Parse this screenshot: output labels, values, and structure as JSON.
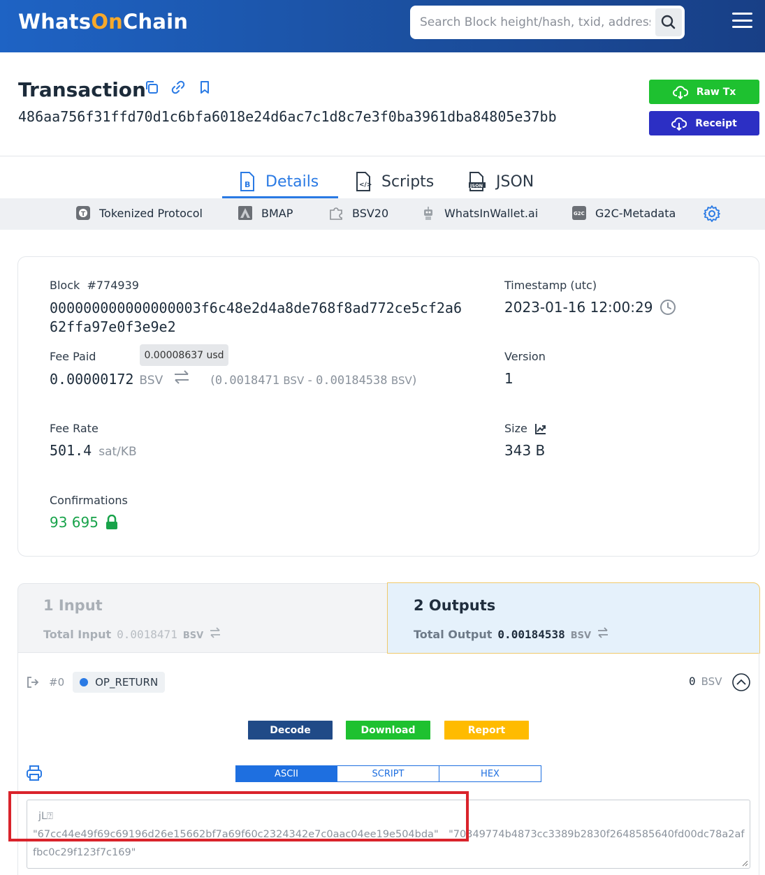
{
  "header": {
    "logo_part1": "Whats",
    "logo_part2": "On",
    "logo_part3": "Chain",
    "search_placeholder": "Search Block height/hash, txid, address"
  },
  "tx": {
    "title": "Transaction",
    "hash": "486aa756f31ffd70d1c6bfa6018e24d6ac7c1d8c7e3f0ba3961dba84805e37bb",
    "raw_tx_label": "Raw Tx",
    "receipt_label": "Receipt"
  },
  "tabs": [
    {
      "label": "Details",
      "icon": "bitcoin-doc-icon"
    },
    {
      "label": "Scripts",
      "icon": "code-doc-icon"
    },
    {
      "label": "JSON",
      "icon": "json-doc-icon"
    }
  ],
  "plugins": [
    {
      "label": "Tokenized Protocol",
      "icon": "tokenized-icon"
    },
    {
      "label": "BMAP",
      "icon": "bmap-icon"
    },
    {
      "label": "BSV20",
      "icon": "puzzle-icon"
    },
    {
      "label": "WhatsInWallet.ai",
      "icon": "robot-icon"
    },
    {
      "label": "G2C-Metadata",
      "icon": "g2c-icon"
    }
  ],
  "details": {
    "block_label": "Block",
    "block_number": "#774939",
    "block_hash_line1": "000000000000000003f6c48e2d4a8de768f8ad772ce5cf2a6",
    "block_hash_line2": "62ffa97e0f3e9e2",
    "timestamp_label": "Timestamp (utc)",
    "timestamp": "2023-01-16 12:00:29",
    "fee_label": "Fee Paid",
    "fee_value": "0.00000172",
    "fee_unit": "BSV",
    "fee_usd_tooltip": "0.00008637 usd",
    "fee_calc_open": "(",
    "fee_calc_in": "0.0018471",
    "fee_calc_in_unit": "BSV",
    "fee_calc_minus": "-",
    "fee_calc_out": "0.00184538",
    "fee_calc_out_unit": "BSV",
    "fee_calc_close": ")",
    "version_label": "Version",
    "version": "1",
    "fee_rate_label": "Fee Rate",
    "fee_rate": "501.4",
    "fee_rate_unit": "sat/KB",
    "size_label": "Size",
    "size": "343 B",
    "confirmations_label": "Confirmations",
    "confirmations": "93 695"
  },
  "io": {
    "inputs_title": "1 Input",
    "total_input_label": "Total Input",
    "total_input": "0.0018471",
    "total_input_unit": "BSV",
    "outputs_title": "2 Outputs",
    "total_output_label": "Total Output",
    "total_output": "0.00184538",
    "total_output_unit": "BSV"
  },
  "output": {
    "index": "#0",
    "type": "OP_RETURN",
    "amount": "0",
    "amount_unit": "BSV",
    "decode_label": "Decode",
    "download_label": "Download",
    "report_label": "Report",
    "formats": [
      "ASCII",
      "SCRIPT",
      "HEX"
    ],
    "active_format": "ASCII",
    "ascii_line1": "jL⍰",
    "ascii_line2": "\"67cc44e49f69c69196d26e15662bf7a69f60c2324342e7c0aac04ee19e504bda\"__\"70349774b4873cc3389b2830f2648585640fd00dc78a2affbc0c29f123f7c169\""
  },
  "colors": {
    "accent": "#2a7ae4",
    "raw_tx_green": "#1ec130",
    "receipt_blue": "#2c2fc4",
    "decode_navy": "#204a87",
    "download_green": "#1ec130",
    "report_amber": "#ffbb00",
    "confirm_green": "#18a34a",
    "highlight_red": "#d9232b"
  }
}
